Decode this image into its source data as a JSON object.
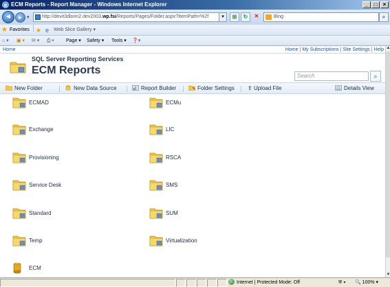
{
  "window": {
    "title": "ECM Reports - Report Manager - Windows Internet Explorer",
    "buttons": [
      "_",
      "□",
      "×"
    ]
  },
  "address_bar": {
    "url_prefix": "http://devit3dlorin2.dev2003.",
    "url_host_bold": "wp.fsi",
    "url_suffix": "/Reports/Pages/Folder.aspx?ItemPath=%2f",
    "search_placeholder": "Bing"
  },
  "favorites_bar": {
    "favorites_label": "Favorites",
    "web_slice_label": "Web Slice Gallery ▾"
  },
  "command_bar": {
    "page_label": "Page ▾",
    "safety_label": "Safety ▾",
    "tools_label": "Tools ▾"
  },
  "top_strip": {
    "home": "Home",
    "links": [
      "Home",
      "My Subscriptions",
      "Site Settings",
      "Help"
    ]
  },
  "header": {
    "subtitle": "SQL Server Reporting Services",
    "title": "ECM Reports",
    "search_placeholder": "Search"
  },
  "toolbar": {
    "new_folder": "New Folder",
    "new_data_source": "New Data Source",
    "report_builder": "Report Builder",
    "folder_settings": "Folder Settings",
    "upload_file": "Upload File",
    "details_view": "Details View"
  },
  "items": {
    "left": [
      "ECMAD",
      "Exchange",
      "Provisioning",
      "Service Desk",
      "Standard",
      "Temp"
    ],
    "right": [
      "ECMu",
      "LIC",
      "RSCA",
      "SMS",
      "SUM",
      "Virtualization"
    ],
    "datasource": "ECM"
  },
  "status_bar": {
    "zone": "Internet | Protected Mode: Off",
    "zoom": "100%"
  },
  "colors": {
    "link": "#1a55a8",
    "title_text": "#2a3a56",
    "folder": "#f2c84b"
  }
}
